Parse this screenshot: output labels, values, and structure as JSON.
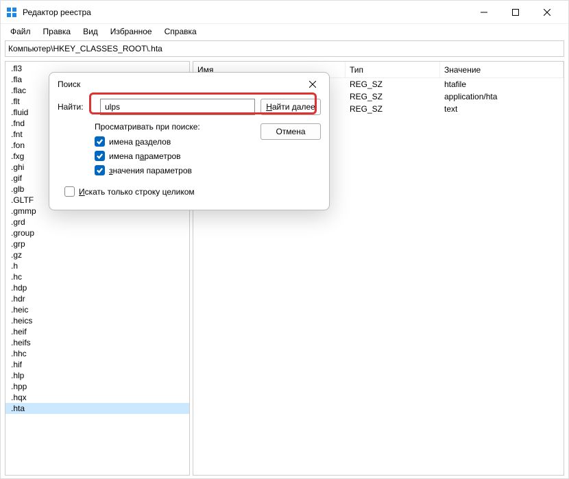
{
  "window": {
    "title": "Редактор реестра"
  },
  "menu": {
    "file": "Файл",
    "edit": "Правка",
    "view": "Вид",
    "favorites": "Избранное",
    "help": "Справка"
  },
  "address": "Компьютер\\HKEY_CLASSES_ROOT\\.hta",
  "tree": {
    "items": [
      ".fl3",
      ".fla",
      ".flac",
      ".flt",
      ".fluid",
      ".fnd",
      ".fnt",
      ".fon",
      ".fxg",
      ".ghi",
      ".gif",
      ".glb",
      ".GLTF",
      ".gmmp",
      ".grd",
      ".group",
      ".grp",
      ".gz",
      ".h",
      ".hc",
      ".hdp",
      ".hdr",
      ".heic",
      ".heics",
      ".heif",
      ".heifs",
      ".hhc",
      ".hif",
      ".hlp",
      ".hpp",
      ".hqx",
      ".hta"
    ],
    "selected": ".hta"
  },
  "columns": {
    "name": "Имя",
    "type": "Тип",
    "value": "Значение"
  },
  "rows": [
    {
      "type": "REG_SZ",
      "value": "htafile"
    },
    {
      "type": "REG_SZ",
      "value": "application/hta"
    },
    {
      "type": "REG_SZ",
      "value": "text"
    }
  ],
  "dialog": {
    "title": "Поиск",
    "find_label": "Найти:",
    "find_value": "ulps",
    "find_next_pre": "Н",
    "find_next_post": "айти далее",
    "cancel": "Отмена",
    "look_at": "Просматривать при поиске:",
    "keys_pre": "имена ",
    "keys_u": "р",
    "keys_post": "азделов",
    "values_pre": "имена п",
    "values_u": "а",
    "values_post": "раметров",
    "data_u": "з",
    "data_post": "начения параметров",
    "whole_u": "И",
    "whole_post": "скать только строку целиком"
  }
}
